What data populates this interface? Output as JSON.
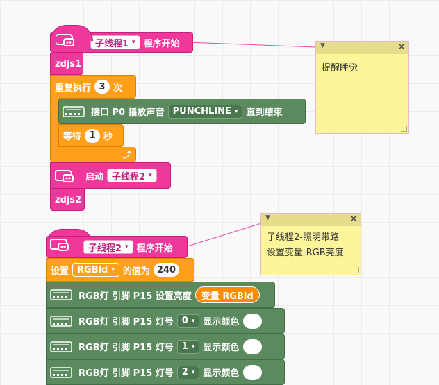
{
  "colors": {
    "thread": "#f0379c",
    "control": "#ff9f1a",
    "device": "#5b8a5e",
    "note": "#fef59b"
  },
  "script1": {
    "hat": {
      "thread": "子线程1",
      "suffix": "程序开始"
    },
    "label_top": "zdjs1",
    "repeat": {
      "prefix": "重复执行",
      "count": "3",
      "suffix": "次"
    },
    "play": {
      "prefix": "接口 P0 播放声音",
      "sound": "PUNCHLINE",
      "suffix": "直到结束"
    },
    "wait": {
      "prefix": "等待",
      "secs": "1",
      "suffix": "秒"
    },
    "loop_arrow": "⤴",
    "start": {
      "prefix": "启动",
      "thread": "子线程2"
    },
    "label_bottom": "zdjs2"
  },
  "script2": {
    "hat": {
      "thread": "子线程2",
      "suffix": "程序开始"
    },
    "set_var": {
      "prefix": "设置",
      "var": "RGBld",
      "mid": "的值为",
      "value": "240"
    },
    "brightness": {
      "prefix": "RGB灯 引脚 P15 设置亮度",
      "reporter": "变量 RGBld"
    },
    "leds": [
      {
        "prefix": "RGB灯 引脚 P15 灯号",
        "index": "0",
        "suffix": "显示颜色",
        "color": "#ffffff"
      },
      {
        "prefix": "RGB灯 引脚 P15 灯号",
        "index": "1",
        "suffix": "显示颜色",
        "color": "#ffffff"
      },
      {
        "prefix": "RGB灯 引脚 P15 灯号",
        "index": "2",
        "suffix": "显示颜色",
        "color": "#ffffff"
      }
    ]
  },
  "notes": [
    {
      "text_lines": [
        "提醒睡觉"
      ]
    },
    {
      "text_lines": [
        "子线程2-照明带路",
        "设置变量-RGB亮度"
      ]
    }
  ],
  "icons": {
    "collapse": "triangle-down-icon",
    "close": "close-icon",
    "dropdown": "▾"
  }
}
